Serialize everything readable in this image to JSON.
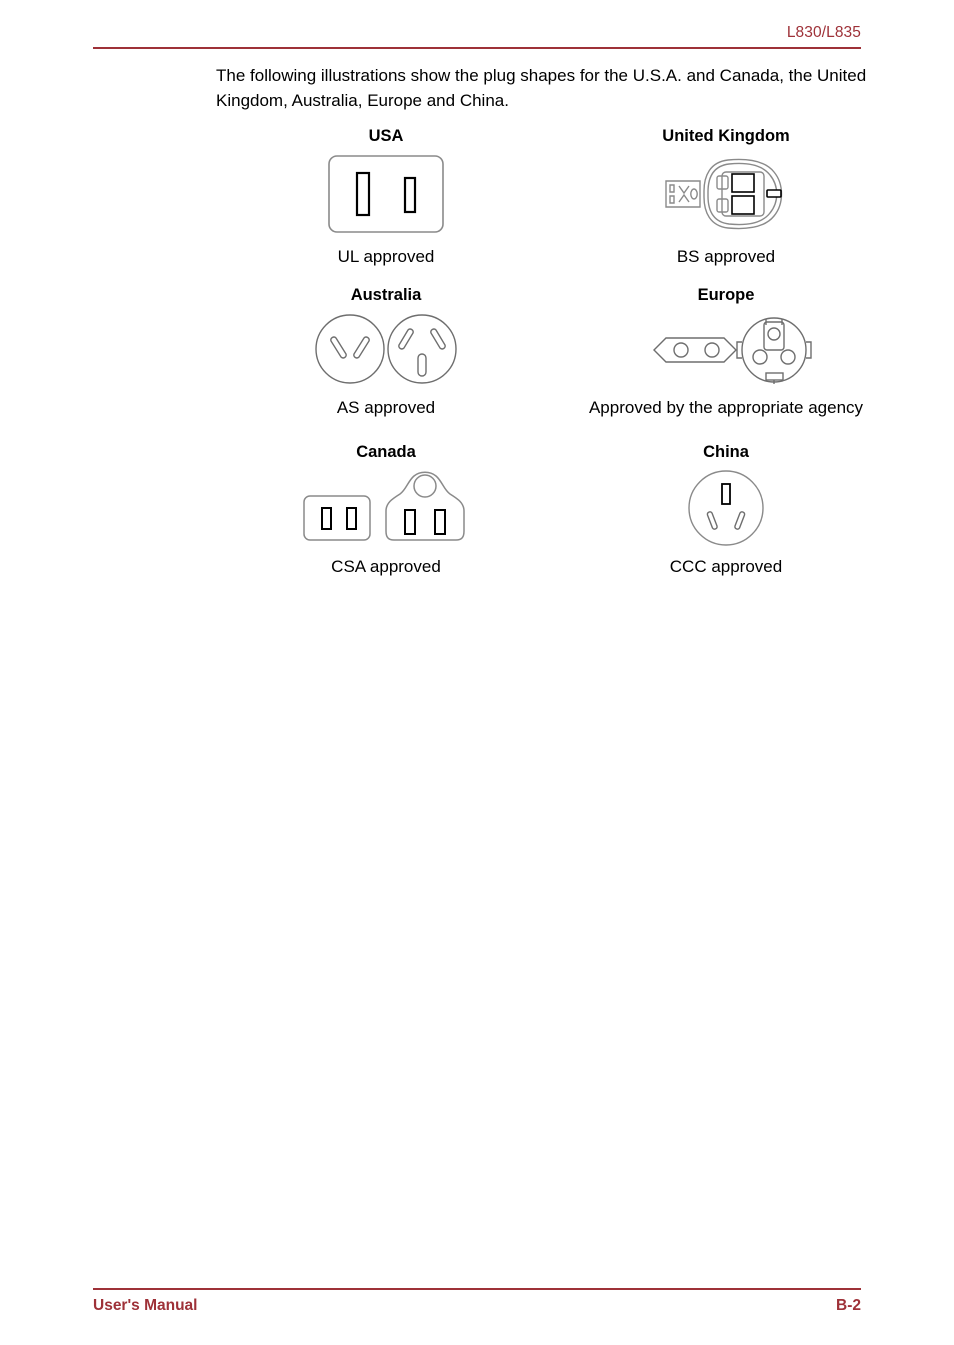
{
  "header": {
    "model": "L830/L835",
    "rule_color": "#9e3138"
  },
  "body": {
    "intro": "The following illustrations show the plug shapes for the U.S.A. and Canada, the United Kingdom, Australia, Europe and China."
  },
  "plugs": [
    {
      "heading": "USA",
      "caption": "UL approved",
      "icon": "usa-plug-icon"
    },
    {
      "heading": "United Kingdom",
      "caption": "BS approved",
      "icon": "uk-plug-icon"
    },
    {
      "heading": "Australia",
      "caption": "AS approved",
      "icon": "australia-plug-icon"
    },
    {
      "heading": "Europe",
      "caption": "Approved by the appropriate agency",
      "icon": "europe-plug-icon"
    },
    {
      "heading": "Canada",
      "caption": "CSA approved",
      "icon": "canada-plug-icon"
    },
    {
      "heading": "China",
      "caption": "CCC approved",
      "icon": "china-plug-icon"
    }
  ],
  "footer": {
    "manual_label": "User's Manual",
    "page_number": "B-2",
    "rule_color": "#9e3138"
  }
}
